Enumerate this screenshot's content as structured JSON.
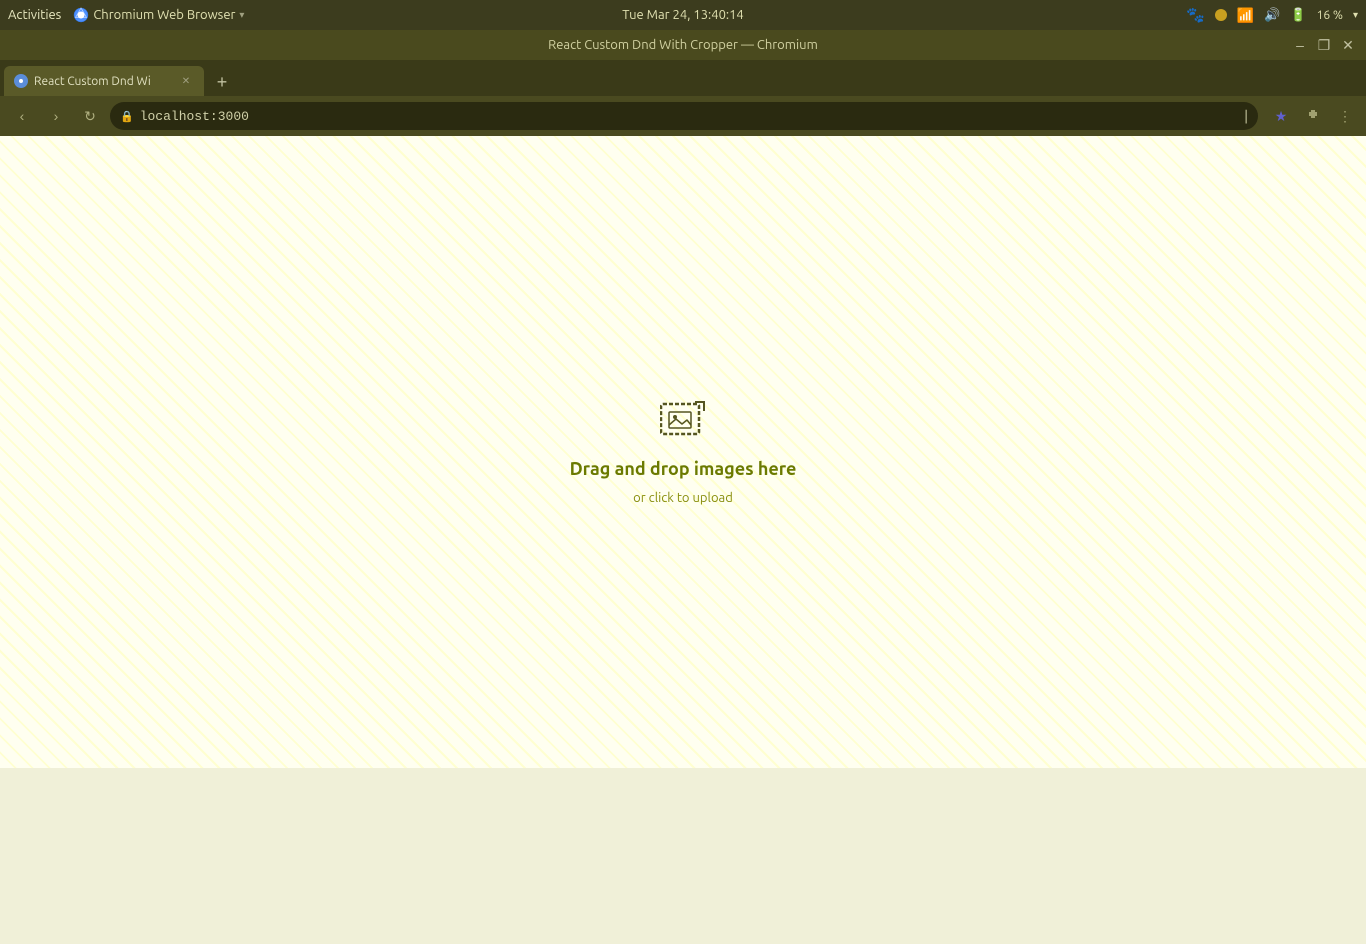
{
  "system_bar": {
    "activities_label": "Activities",
    "browser_name": "Chromium Web Browser",
    "datetime": "Tue Mar 24, 13:40:14",
    "battery_percent": "16 %"
  },
  "title_bar": {
    "title": "React Custom Dnd With Cropper — Chromium",
    "minimize_label": "–",
    "restore_label": "❐",
    "close_label": "✕"
  },
  "tab": {
    "title": "React Custom Dnd Wi",
    "url": "localhost:3000",
    "new_tab_label": "+"
  },
  "nav": {
    "back_label": "‹",
    "forward_label": "›",
    "reload_label": "↻"
  },
  "drop_zone": {
    "main_text": "Drag and drop images here",
    "sub_text": "or click to upload"
  },
  "icons": {
    "upload_image": "⊡"
  }
}
